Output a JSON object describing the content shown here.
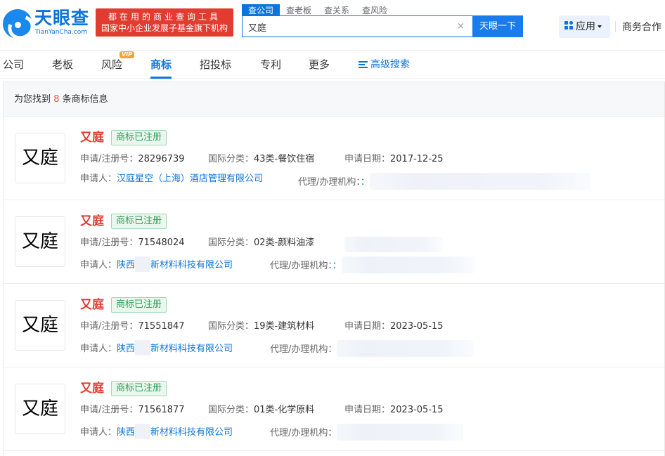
{
  "header": {
    "logo_cn": "天眼查",
    "logo_en": "TianYanCha.com",
    "promo_line1": "都在用的商业查询工具",
    "promo_line2": "国家中小企业发展子基金旗下机构",
    "search_tabs": [
      "查公司",
      "查老板",
      "查关系",
      "查风险"
    ],
    "search_value": "又庭",
    "clear": "×",
    "search_button": "天眼一下",
    "app_button": "应用",
    "biz_link": "商务合作"
  },
  "tabs": {
    "items": [
      "公司",
      "老板",
      "风险",
      "商标",
      "招投标",
      "专利",
      "更多"
    ],
    "active": "商标",
    "vip_badge": "VIP",
    "advanced_search": "高级搜索"
  },
  "summary": {
    "prefix": "为您找到",
    "count": "8",
    "suffix": "条商标信息"
  },
  "labels": {
    "reg_no": "申请/注册号：",
    "intl_class": "国际分类：",
    "apply_date": "申请日期：",
    "applicant": "申请人：",
    "agency": "代理/办理机构："
  },
  "results": [
    {
      "image_text": "又庭",
      "name": "又庭",
      "status": "商标已注册",
      "reg_no": "28296739",
      "intl_class": "43类-餐饮住宿",
      "apply_date": "2017-12-25",
      "applicant": "汉庭星空（上海）酒店管理有限公司",
      "agency_partial": "："
    },
    {
      "image_text": "又庭",
      "name": "又庭",
      "status": "商标已注册",
      "reg_no": "71548024",
      "intl_class": "02类-颜料油漆",
      "applicant_prefix": "陕西",
      "applicant_suffix": "新材料科技有限公司",
      "agency_partial": "："
    },
    {
      "image_text": "又庭",
      "name": "又庭",
      "status": "商标已注册",
      "reg_no": "71551847",
      "intl_class": "19类-建筑材料",
      "apply_date": "2023-05-15",
      "applicant_prefix": "陕西",
      "applicant_suffix": "新材料科技有限公司"
    },
    {
      "image_text": "又庭",
      "name": "又庭",
      "status": "商标已注册",
      "reg_no": "71561877",
      "intl_class": "01类-化学原料",
      "apply_date": "2023-05-15",
      "applicant_prefix": "陕西",
      "applicant_suffix": "新材料科技有限公司"
    }
  ],
  "colors": {
    "brand_blue": "#0c74dc",
    "promo_red": "#e23b30",
    "trademark_red": "#e23b30",
    "status_green": "#2f9e5a",
    "count_orange": "#e5593d",
    "vip_orange": "#f0a53b"
  },
  "icons": {
    "logo": "eye-logo-icon",
    "clear": "close-icon",
    "apps": "grid-icon",
    "dropdown": "caret-down-icon",
    "advanced_search": "filter-lines-icon"
  }
}
